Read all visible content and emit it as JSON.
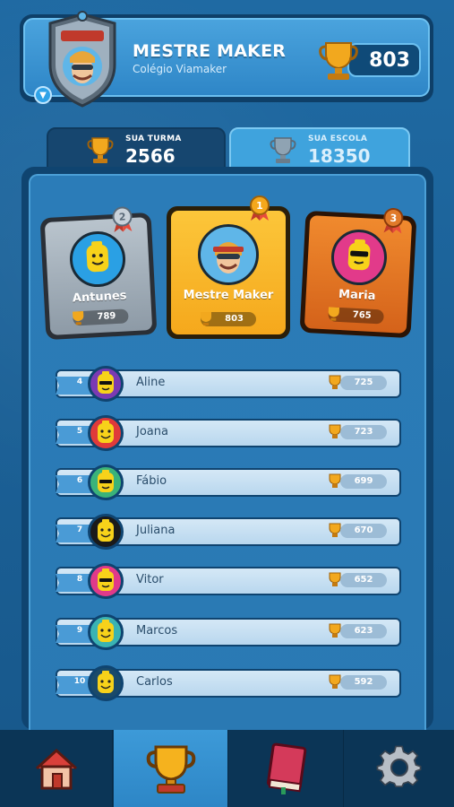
{
  "header": {
    "player_name": "MESTRE MAKER",
    "school": "Colégio Viamaker",
    "score": "803"
  },
  "tabs": [
    {
      "label": "SUA TURMA",
      "value": "2566",
      "active": true
    },
    {
      "label": "SUA ESCOLA",
      "value": "18350",
      "active": false
    }
  ],
  "podium": [
    {
      "rank": "2",
      "name": "Antunes",
      "score": "789",
      "color": "#9aa7b2"
    },
    {
      "rank": "1",
      "name": "Mestre Maker",
      "score": "803",
      "color": "#f6b82b"
    },
    {
      "rank": "3",
      "name": "Maria",
      "score": "765",
      "color": "#e07a2a"
    }
  ],
  "ranking": [
    {
      "rank": "4",
      "name": "Aline",
      "score": "725",
      "ring": "#7b3ab3",
      "face": "cool"
    },
    {
      "rank": "5",
      "name": "Joana",
      "score": "723",
      "ring": "#e03a3a",
      "face": "smile"
    },
    {
      "rank": "6",
      "name": "Fábio",
      "score": "699",
      "ring": "#3ab37a",
      "face": "cool"
    },
    {
      "rank": "7",
      "name": "Juliana",
      "score": "670",
      "ring": "#1a1a1a",
      "face": "smile"
    },
    {
      "rank": "8",
      "name": "Vitor",
      "score": "652",
      "ring": "#e03a8a",
      "face": "cool"
    },
    {
      "rank": "9",
      "name": "Marcos",
      "score": "623",
      "ring": "#3ab3b3",
      "face": "smile"
    },
    {
      "rank": "10",
      "name": "Carlos",
      "score": "592",
      "ring": "#1a4a6a",
      "face": "smile"
    }
  ],
  "nav": [
    {
      "name": "home-icon",
      "active": false
    },
    {
      "name": "trophy-icon",
      "active": true
    },
    {
      "name": "book-icon",
      "active": false
    },
    {
      "name": "gear-icon",
      "active": false
    }
  ]
}
